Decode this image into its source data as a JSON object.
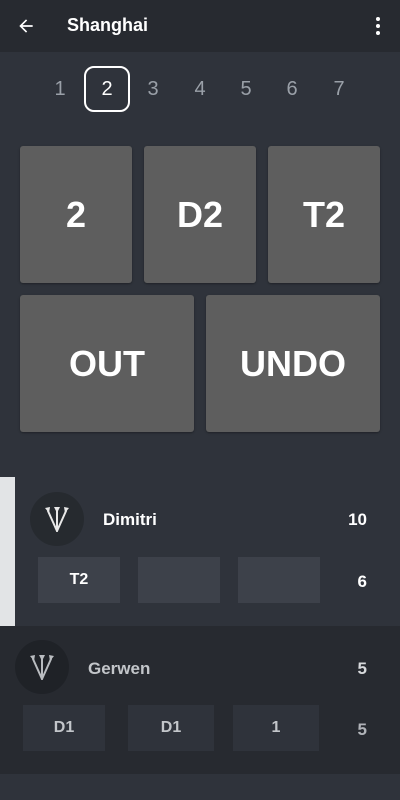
{
  "appbar": {
    "title": "Shanghai",
    "back_icon": "arrow-left-icon",
    "menu_icon": "more-vertical-icon"
  },
  "rounds": {
    "items": [
      "1",
      "2",
      "3",
      "4",
      "5",
      "6",
      "7"
    ],
    "selected": "2"
  },
  "keypad": {
    "single": "2",
    "double": "D2",
    "triple": "T2",
    "out": "OUT",
    "undo": "UNDO"
  },
  "players": [
    {
      "name": "Dimitri",
      "total": "10",
      "darts": [
        "T2",
        "",
        ""
      ],
      "round_score": "6",
      "active": true,
      "avatar_icon": "darts-icon"
    },
    {
      "name": "Gerwen",
      "total": "5",
      "darts": [
        "D1",
        "D1",
        "1"
      ],
      "round_score": "5",
      "active": false,
      "avatar_icon": "darts-icon"
    }
  ],
  "colors": {
    "background": "#2f333b",
    "appbar": "#272a30",
    "tile": "#5e5e5e",
    "active_dart_box": "#3d414a",
    "inactive_dart_box": "#2f333b",
    "active_indicator": "#e2e4e6"
  }
}
